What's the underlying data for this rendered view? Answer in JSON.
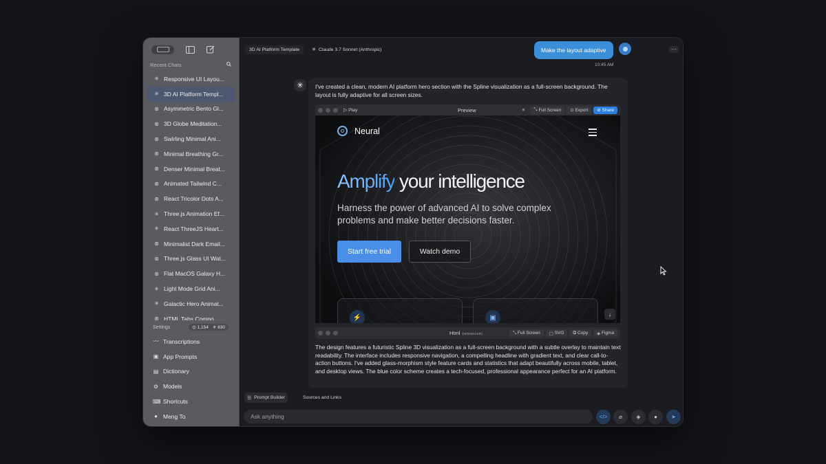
{
  "sidebar": {
    "recent_label": "Recent Chats",
    "chats": [
      {
        "label": "Responsive UI Layou...",
        "icon": "sparkle-icon"
      },
      {
        "label": "3D AI Platform Templ...",
        "icon": "sparkle-icon",
        "active": true
      },
      {
        "label": "Asymmetric Bento Gl...",
        "icon": "openai-icon"
      },
      {
        "label": "3D Globe Meditation...",
        "icon": "openai-icon"
      },
      {
        "label": "Swirling Minimal Ani...",
        "icon": "openai-icon"
      },
      {
        "label": "Minimal Breathing Gr...",
        "icon": "openai-icon"
      },
      {
        "label": "Denser Minimal Breat...",
        "icon": "openai-icon"
      },
      {
        "label": "Animated Tailwind C...",
        "icon": "openai-icon"
      },
      {
        "label": "React Tricolor Dots A...",
        "icon": "openai-icon"
      },
      {
        "label": "Three.js Animation Ef...",
        "icon": "sparkle-icon"
      },
      {
        "label": "React ThreeJS Heart...",
        "icon": "sparkle-icon"
      },
      {
        "label": "Minimalist Dark Email...",
        "icon": "openai-icon"
      },
      {
        "label": "Three.js Glass UI Wat...",
        "icon": "openai-icon"
      },
      {
        "label": "Flat MacOS Galaxy H...",
        "icon": "openai-icon"
      },
      {
        "label": "Light Mode Grid Ani...",
        "icon": "sparkle-icon"
      },
      {
        "label": "Galactic Hero Animat...",
        "icon": "sparkle-icon"
      },
      {
        "label": "HTML Tabs Compo...",
        "icon": "openai-icon"
      }
    ],
    "settings_label": "Settings",
    "count_a": "1,154",
    "count_b": "830",
    "menu": [
      {
        "label": "Transcriptions",
        "icon": "waveform-icon"
      },
      {
        "label": "App Prompts",
        "icon": "terminal-icon"
      },
      {
        "label": "Dictionary",
        "icon": "book-icon"
      },
      {
        "label": "Models",
        "icon": "gear-icon"
      },
      {
        "label": "Shortcuts",
        "icon": "keyboard-icon"
      },
      {
        "label": "Meng To",
        "icon": "user-icon"
      }
    ]
  },
  "header": {
    "tab_project": "3D AI Platform Template",
    "tab_model": "Claude 3.7 Sonnet (Anthropic)"
  },
  "chat": {
    "user_message": "Make the layout adaptive",
    "timestamp": "10:45 AM",
    "assistant_intro": "I've created a clean, modern AI platform hero section with the Spline visualization as a full-screen background. The layout is fully adaptive for all screen sizes.",
    "assistant_description": "The design features a futuristic Spline 3D visualization as a full-screen background with a subtle overlay to maintain text readability. The interface includes responsive navigation, a compelling headline with gradient text, and clear call-to-action buttons. I've added glass-morphism style feature cards and statistics that adapt beautifully across mobile, tablet, and desktop views. The blue color scheme creates a tech-focused, professional appearance perfect for an AI platform."
  },
  "preview": {
    "play_label": "Play",
    "title": "Preview",
    "fullscreen_label": "Full Screen",
    "export_label": "Export",
    "share_label": "Share",
    "brand": "Neural",
    "headline_accent": "Amplify",
    "headline_rest": " your intelligence",
    "subhead": "Harness the power of advanced AI to solve complex problems and make better decisions faster.",
    "cta_primary": "Start free trial",
    "cta_secondary": "Watch demo"
  },
  "code_bar": {
    "title": "Html",
    "badge": "(MINIMIZED)",
    "fullscreen_label": "Full Screen",
    "svg_label": "SVG",
    "copy_label": "Copy",
    "figma_label": "Figma"
  },
  "footer": {
    "tab_prompt_builder": "Prompt Builder",
    "tab_sources": "Sources and Links",
    "input_placeholder": "Ask anything"
  },
  "colors": {
    "accent": "#3a8fd8",
    "gradient_start": "#8dc8ff",
    "gradient_end": "#4f9ef0",
    "sidebar_bg": "#5a5b60"
  }
}
